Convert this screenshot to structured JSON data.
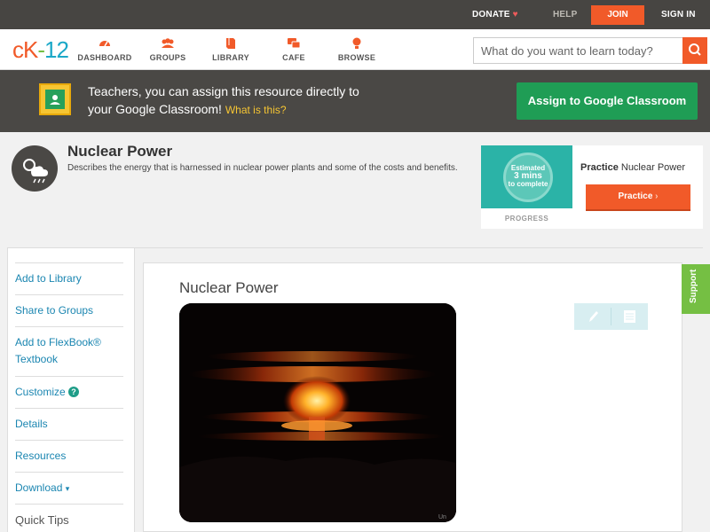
{
  "topbar": {
    "donate": "DONATE",
    "help": "HELP",
    "join": "JOIN",
    "signin": "SIGN IN"
  },
  "nav": {
    "logo": {
      "c": "c",
      "k": "K",
      "dash": "-",
      "num": "12"
    },
    "items": [
      {
        "label": "DASHBOARD",
        "icon": "dashboard-icon"
      },
      {
        "label": "GROUPS",
        "icon": "groups-icon"
      },
      {
        "label": "LIBRARY",
        "icon": "library-icon"
      },
      {
        "label": "CAFE",
        "icon": "cafe-icon"
      },
      {
        "label": "BROWSE",
        "icon": "browse-icon"
      }
    ],
    "search_placeholder": "What do you want to learn today?"
  },
  "banner": {
    "line1": "Teachers, you can assign this resource directly to",
    "line2": "your Google Classroom!",
    "what": "What is this?",
    "assign": "Assign to Google Classroom"
  },
  "concept": {
    "title": "Nuclear Power",
    "description": "Describes the energy that is harnessed in nuclear power plants and some of the costs and benefits."
  },
  "practice": {
    "estimated": "Estimated",
    "mins": "3 mins",
    "complete": "to complete",
    "progress": "PROGRESS",
    "heading_bold": "Practice",
    "heading_rest": "Nuclear Power",
    "button": "Practice"
  },
  "sidebar": {
    "items": [
      {
        "label": "Add to Library"
      },
      {
        "label": "Share to Groups"
      },
      {
        "label": "Add to FlexBook®",
        "label2": "Textbook"
      },
      {
        "label": "Customize"
      },
      {
        "label": "Details"
      },
      {
        "label": "Resources"
      },
      {
        "label": "Download"
      },
      {
        "label": "Quick Tips"
      }
    ],
    "help_glyph": "?",
    "caret": "▾"
  },
  "content": {
    "title": "Nuclear Power",
    "image_caption": "Un"
  },
  "support": "Support",
  "colors": {
    "accent": "#f15a29",
    "green": "#1f9d55",
    "banner": "#4a4845",
    "link": "#1b86b1"
  }
}
